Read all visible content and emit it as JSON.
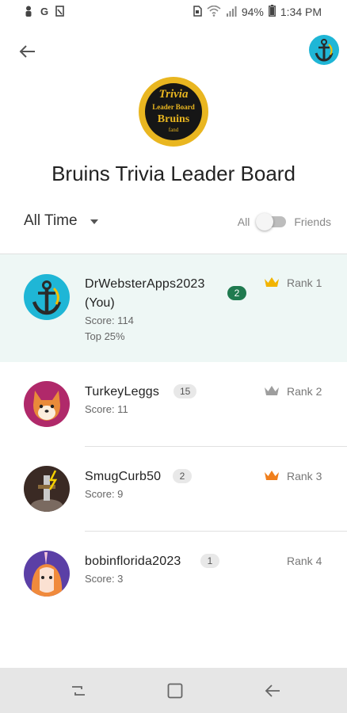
{
  "status_bar": {
    "left_icons": [
      "person-icon",
      "google-icon",
      "blocked-image-icon"
    ],
    "battery": "94%",
    "time": "1:34 PM"
  },
  "logo": {
    "line1": "Trivia",
    "line2": "Leader Board",
    "line3": "Bruins",
    "line4": "fand"
  },
  "page": {
    "title": "Bruins Trivia Leader Board"
  },
  "filters": {
    "period": "All Time",
    "toggle_left": "All",
    "toggle_right": "Friends",
    "toggle_state": "All"
  },
  "leaderboard": [
    {
      "name": "DrWebsterApps2023",
      "suffix": "(You)",
      "badge": "2",
      "score": "Score: 114",
      "extra": "Top 25%",
      "rank": "Rank 1",
      "crown_color": "#f2b400",
      "highlight": true
    },
    {
      "name": "TurkeyLeggs",
      "badge": "15",
      "score": "Score: 11",
      "rank": "Rank 2",
      "crown_color": "#9e9e9e"
    },
    {
      "name": "SmugCurb50",
      "badge": "2",
      "score": "Score: 9",
      "rank": "Rank 3",
      "crown_color": "#f07f1c"
    },
    {
      "name": "bobinflorida2023",
      "badge": "1",
      "score": "Score: 3",
      "rank": "Rank 4"
    }
  ],
  "colors": {
    "accent_green": "#1f7a4f",
    "highlight_bg": "#eef7f5",
    "avatar_teal": "#1fb6d6"
  }
}
